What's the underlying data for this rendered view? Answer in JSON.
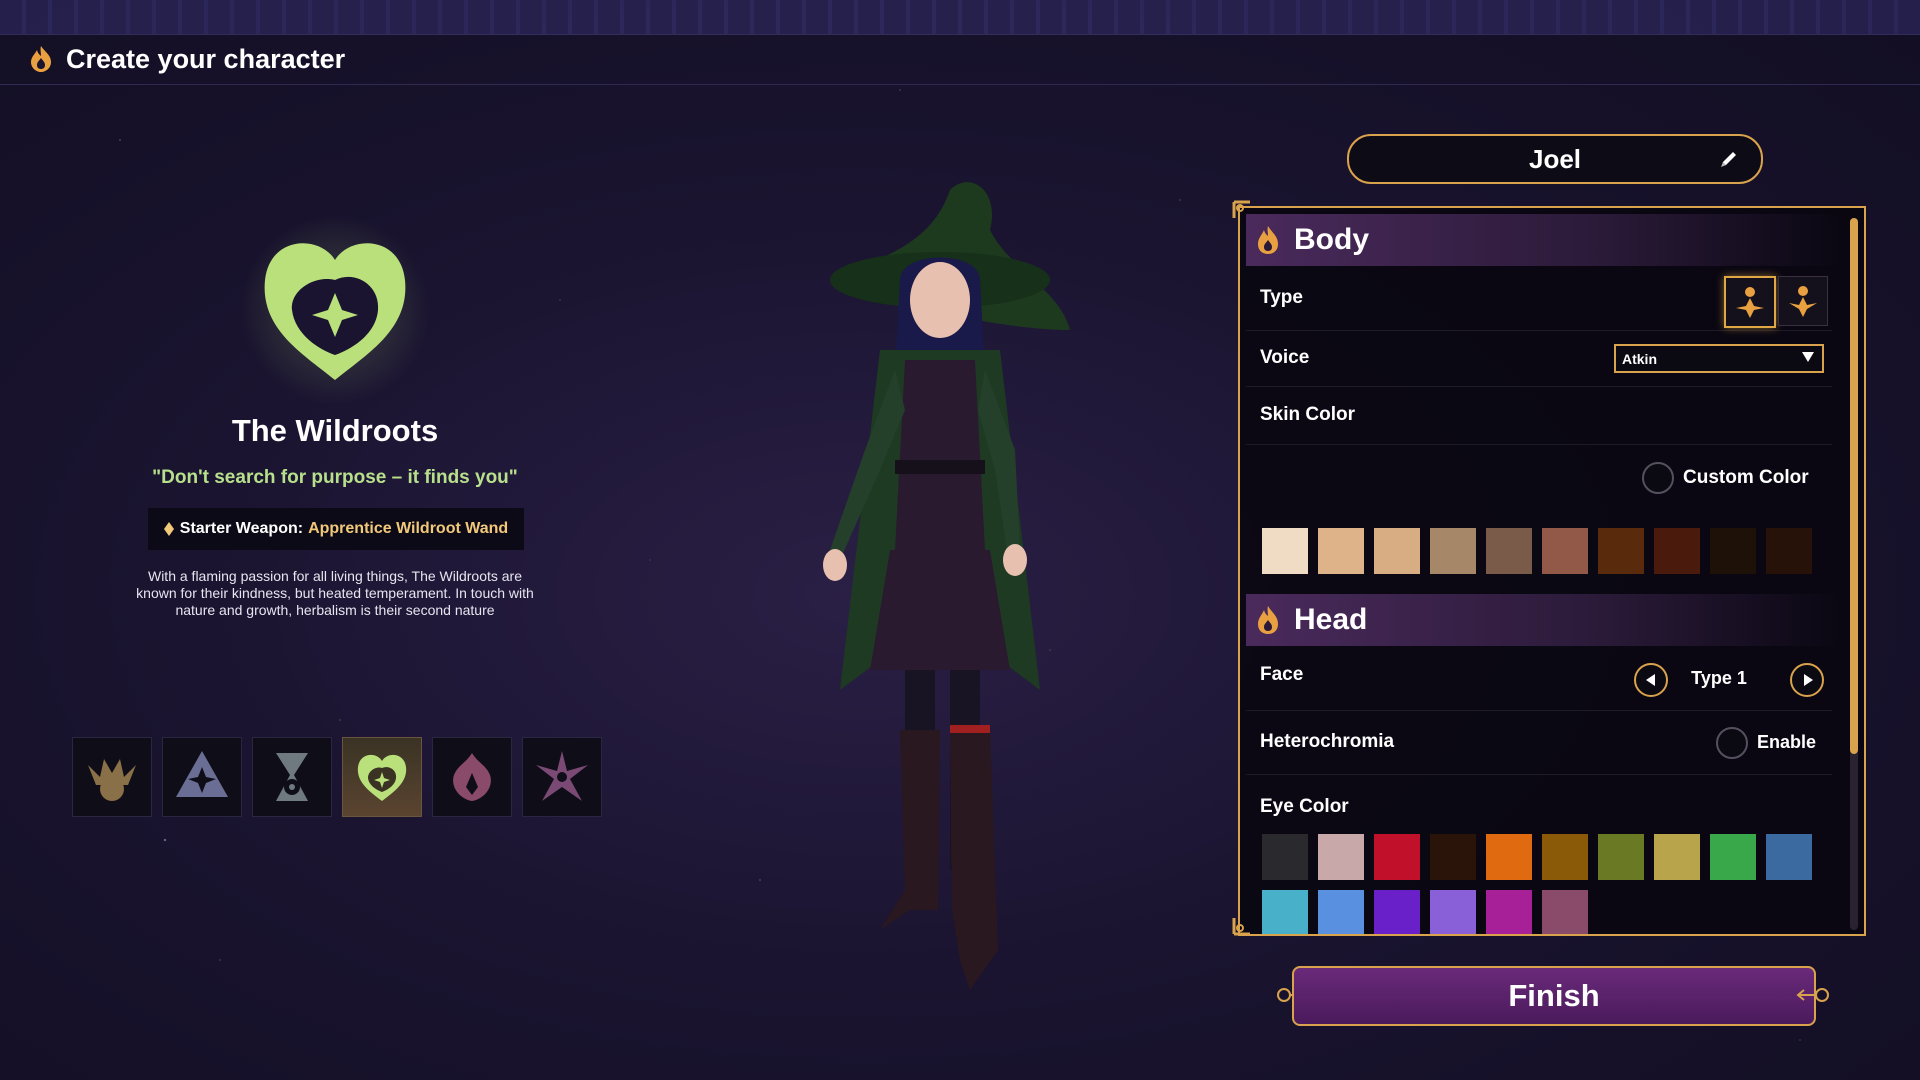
{
  "header": {
    "title": "Create your character"
  },
  "faction": {
    "name": "The Wildroots",
    "quote": "\"Don't search for purpose – it finds you\"",
    "weapon_label": "Starter Weapon:",
    "weapon_value": "Apprentice Wildroot Wand",
    "description": "With a flaming passion for all living things, The Wildroots are known for their kindness, but heated temperament. In touch with nature and growth, herbalism is their second nature",
    "options": [
      {
        "icon": "sun-crown-icon",
        "color": "#8a7048",
        "active": false
      },
      {
        "icon": "star-triangle-icon",
        "color": "#6a6e94",
        "active": false
      },
      {
        "icon": "eye-hourglass-icon",
        "color": "#6f7a80",
        "active": false
      },
      {
        "icon": "wildroots-heart-icon",
        "color": "#b9e07a",
        "active": true
      },
      {
        "icon": "flame-flower-icon",
        "color": "#8a4a6a",
        "active": false
      },
      {
        "icon": "spiky-star-icon",
        "color": "#7a4a74",
        "active": false
      }
    ]
  },
  "character": {
    "name": "Joel"
  },
  "body": {
    "title": "Body",
    "type_label": "Type",
    "voice_label": "Voice",
    "voice_value": "Atkin",
    "skin_label": "Skin Color",
    "custom_color_label": "Custom Color",
    "skin_colors": [
      "#f0dcc4",
      "#deb38a",
      "#d8ad84",
      "#a68868",
      "#7a5a48",
      "#925848",
      "#5a2a0c",
      "#4a1a0c",
      "#1e1208",
      "#261208"
    ]
  },
  "head": {
    "title": "Head",
    "face_label": "Face",
    "face_value": "Type 1",
    "heterochromia_label": "Heterochromia",
    "enable_label": "Enable",
    "eye_label": "Eye Color",
    "eye_colors_row1": [
      "#2a2a2e",
      "#c8a8a8",
      "#c0102a",
      "#2a140a",
      "#e06a10",
      "#8a5a08",
      "#6a7a24",
      "#b8a44a",
      "#38a84a",
      "#3a6aa0"
    ],
    "eye_colors_row2": [
      "#48b0c8",
      "#5a90e0",
      "#6a20c8",
      "#8a60d8",
      "#a82098",
      "#8a4a6a"
    ]
  },
  "actions": {
    "finish_label": "Finish"
  },
  "colors": {
    "accent": "#d9a24c",
    "faction_green": "#b8e08c"
  }
}
